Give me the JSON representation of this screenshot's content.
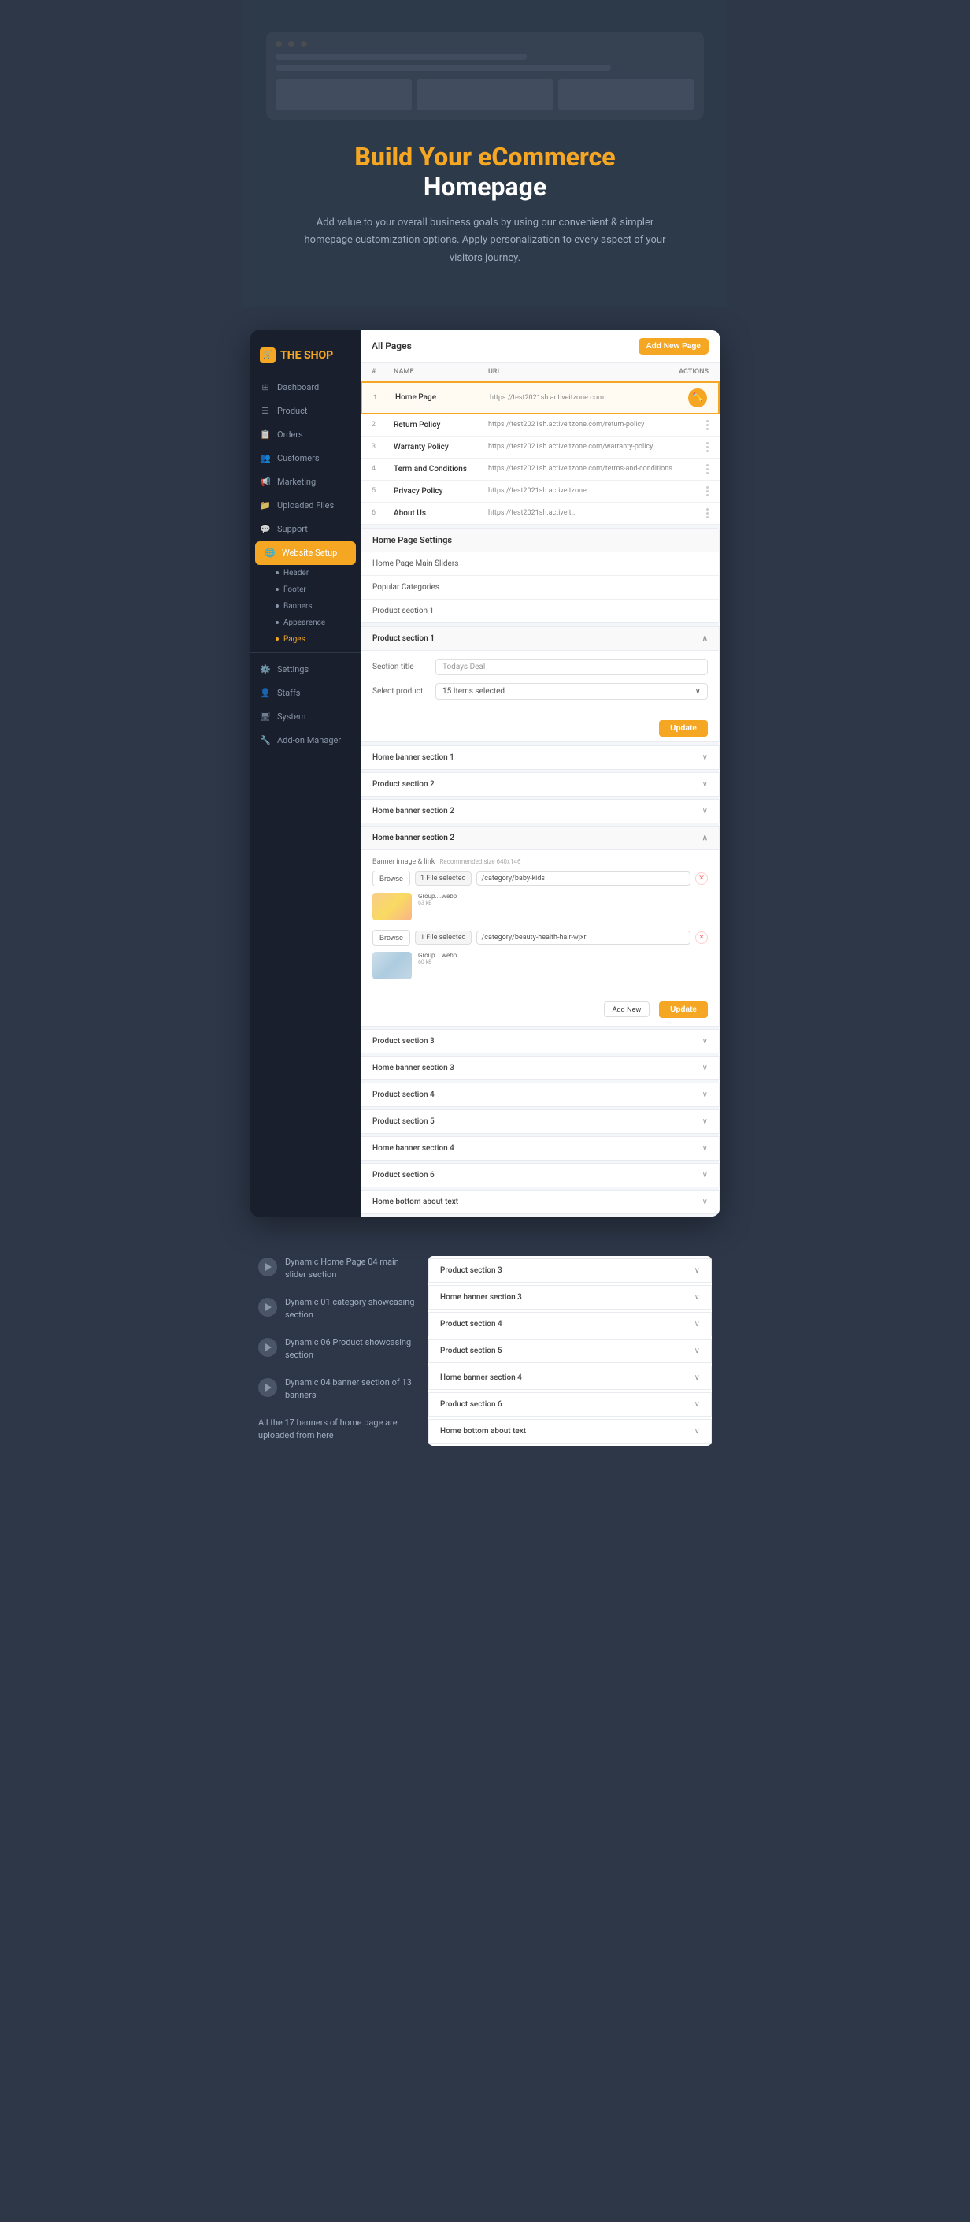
{
  "hero": {
    "title_orange": "Build Your eCommerce",
    "title_white": "Homepage",
    "description": "Add value to your overall business goals by using our convenient & simpler homepage customization options. Apply personalization to every aspect of your visitors journey."
  },
  "sidebar": {
    "logo": "THE SHOP",
    "items": [
      {
        "id": "dashboard",
        "label": "Dashboard",
        "icon": "⊞"
      },
      {
        "id": "product",
        "label": "Product",
        "icon": "☰"
      },
      {
        "id": "orders",
        "label": "Orders",
        "icon": "📋"
      },
      {
        "id": "customers",
        "label": "Customers",
        "icon": "👥"
      },
      {
        "id": "marketing",
        "label": "Marketing",
        "icon": "📢"
      },
      {
        "id": "uploaded-files",
        "label": "Uploaded Files",
        "icon": "📁"
      },
      {
        "id": "support",
        "label": "Support",
        "icon": "💬"
      },
      {
        "id": "website-setup",
        "label": "Website Setup",
        "icon": "🌐",
        "active": true
      },
      {
        "id": "settings",
        "label": "Settings",
        "icon": "⚙️"
      },
      {
        "id": "staffs",
        "label": "Staffs",
        "icon": "👤"
      },
      {
        "id": "system",
        "label": "System",
        "icon": "🖥"
      },
      {
        "id": "add-on-manager",
        "label": "Add-on Manager",
        "icon": "🔧"
      }
    ],
    "sub_items": [
      {
        "id": "header",
        "label": "Header"
      },
      {
        "id": "footer",
        "label": "Footer"
      },
      {
        "id": "banners",
        "label": "Banners"
      },
      {
        "id": "appearence",
        "label": "Appearence"
      },
      {
        "id": "pages",
        "label": "Pages",
        "active": true
      }
    ]
  },
  "pages": {
    "title": "All Pages",
    "add_button": "Add New Page",
    "columns": [
      "#",
      "Name",
      "URL",
      "Actions"
    ],
    "rows": [
      {
        "num": "1",
        "name": "Home Page",
        "url": "https://test2021sh.activeitzone.com",
        "highlighted": true
      },
      {
        "num": "2",
        "name": "Return Policy",
        "url": "https://test2021sh.activeitzone.com/return-policy"
      },
      {
        "num": "3",
        "name": "Warranty Policy",
        "url": "https://test2021sh.activeitzone.com/warranty-policy"
      },
      {
        "num": "4",
        "name": "Term and Conditions",
        "url": "https://test2021sh.activeitzone.com/terms-and-conditions"
      },
      {
        "num": "5",
        "name": "Privacy Policy",
        "url": "https://test2021sh.activeitzone..."
      },
      {
        "num": "6",
        "name": "About Us",
        "url": "https://test2021sh.activeit..."
      }
    ]
  },
  "homepage_settings": {
    "title": "Home Page Settings",
    "items": [
      "Home Page Main Sliders",
      "Popular Categories",
      "Product section 1"
    ]
  },
  "product_section_1": {
    "title": "Product section 1",
    "section_title_label": "Section title",
    "section_title_value": "Todays Deal",
    "select_product_label": "Select product",
    "select_product_value": "15 Items selected",
    "update_button": "Update"
  },
  "collapsed_sections_1": [
    "Home banner section 1",
    "Product section 2",
    "Home banner section 2"
  ],
  "banner_section_2": {
    "title": "Home banner section 2",
    "label": "Banner image & link",
    "sublabel": "Recommended size 640x146",
    "files": [
      {
        "selected_text": "1 File selected",
        "path": "/category/baby-kids",
        "thumb_name": "Group....webp",
        "thumb_size": "63 kB"
      },
      {
        "selected_text": "1 File selected",
        "path": "/category/beauty-health-hair-wjxr",
        "thumb_name": "Group....webp",
        "thumb_size": "60 kB"
      }
    ],
    "add_new_button": "Add New",
    "update_button": "Update"
  },
  "collapsed_sections_2": [
    "Product section 3",
    "Home banner section 3",
    "Product section 4",
    "Product section 5",
    "Home banner section 4",
    "Product section 6",
    "Home bottom about text"
  ],
  "info_items": [
    {
      "title": "Dynamic Home Page 04 main slider section"
    },
    {
      "title": "Dynamic 01 category showcasing section"
    },
    {
      "title": "Dynamic 06 Product showcasing section"
    },
    {
      "title": "Dynamic 04 banner section of 13 banners"
    }
  ],
  "info_note": "All the 17 banners of home page are uploaded from here"
}
